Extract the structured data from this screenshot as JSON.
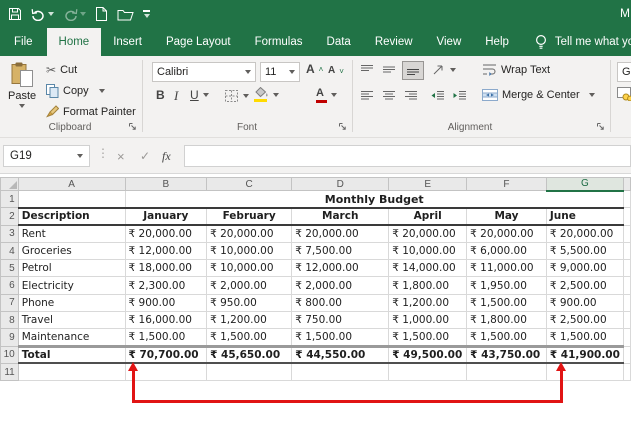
{
  "titlebar": {
    "workbook_title_partial": "M"
  },
  "tabs": {
    "file": "File",
    "home": "Home",
    "insert": "Insert",
    "page_layout": "Page Layout",
    "formulas": "Formulas",
    "data": "Data",
    "review": "Review",
    "view": "View",
    "help": "Help",
    "tell_me": "Tell me what you want to d"
  },
  "ribbon": {
    "clipboard": {
      "group_label": "Clipboard",
      "paste": "Paste",
      "cut": "Cut",
      "copy": "Copy",
      "format_painter": "Format Painter"
    },
    "font": {
      "group_label": "Font",
      "font_name": "Calibri",
      "font_size": "11",
      "bold": "B",
      "italic": "I",
      "underline": "U",
      "grow": "A",
      "shrink": "A",
      "color_a": "A"
    },
    "alignment": {
      "group_label": "Alignment",
      "wrap_text": "Wrap Text",
      "merge_center": "Merge & Center"
    },
    "number": {
      "format_partial": "Ger"
    }
  },
  "formula_bar": {
    "name_box": "G19",
    "cancel": "×",
    "enter": "✓",
    "fx_label": "fx",
    "dots": "⋮"
  },
  "sheet": {
    "columns": [
      "A",
      "B",
      "C",
      "D",
      "E",
      "F",
      "G"
    ],
    "selected_column": "G",
    "row_numbers": [
      "1",
      "2",
      "3",
      "4",
      "5",
      "6",
      "7",
      "8",
      "9",
      "10",
      "11"
    ],
    "title": "Monthly Budget",
    "header": {
      "description": "Description",
      "months": [
        "January",
        "February",
        "March",
        "April",
        "May",
        "June"
      ]
    },
    "rows": [
      {
        "label": "Rent",
        "values": [
          "₹ 20,000.00",
          "₹ 20,000.00",
          "₹ 20,000.00",
          "₹ 20,000.00",
          "₹ 20,000.00",
          "₹ 20,000.00"
        ]
      },
      {
        "label": "Groceries",
        "values": [
          "₹ 12,000.00",
          "₹ 10,000.00",
          "₹ 7,500.00",
          "₹ 10,000.00",
          "₹ 6,000.00",
          "₹ 5,500.00"
        ]
      },
      {
        "label": "Petrol",
        "values": [
          "₹ 18,000.00",
          "₹ 10,000.00",
          "₹ 12,000.00",
          "₹ 14,000.00",
          "₹ 11,000.00",
          "₹ 9,000.00"
        ]
      },
      {
        "label": "Electricity",
        "values": [
          "₹ 2,300.00",
          "₹ 2,000.00",
          "₹ 2,000.00",
          "₹ 1,800.00",
          "₹ 1,950.00",
          "₹ 2,500.00"
        ]
      },
      {
        "label": "Phone",
        "values": [
          "₹ 900.00",
          "₹ 950.00",
          "₹ 800.00",
          "₹ 1,200.00",
          "₹ 1,500.00",
          "₹ 900.00"
        ]
      },
      {
        "label": "Travel",
        "values": [
          "₹ 16,000.00",
          "₹ 1,200.00",
          "₹ 750.00",
          "₹ 1,000.00",
          "₹ 1,800.00",
          "₹ 2,500.00"
        ]
      },
      {
        "label": "Maintenance",
        "values": [
          "₹ 1,500.00",
          "₹ 1,500.00",
          "₹ 1,500.00",
          "₹ 1,500.00",
          "₹ 1,500.00",
          "₹ 1,500.00"
        ]
      }
    ],
    "total_row": {
      "label": "Total",
      "values": [
        "₹ 70,700.00",
        "₹ 45,650.00",
        "₹ 44,550.00",
        "₹ 49,500.00",
        "₹ 43,750.00",
        "₹ 41,900.00"
      ]
    }
  },
  "colors": {
    "brand_green": "#217346",
    "arrow_red": "#e11414",
    "fill_swatch_yellow": "#ffdb00",
    "font_color_swatch_red": "#c00000"
  }
}
